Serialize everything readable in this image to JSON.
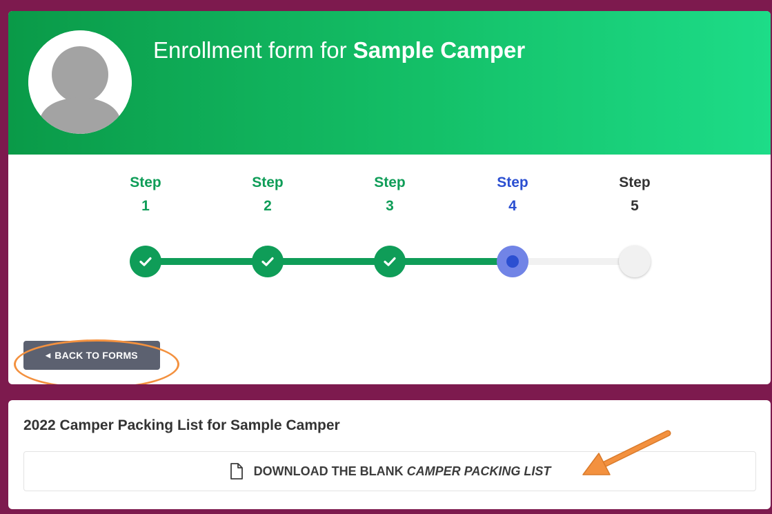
{
  "header": {
    "title_prefix": "Enrollment form for ",
    "camper_name": "Sample Camper",
    "avatar_icon": "user-silhouette-icon"
  },
  "steps": [
    {
      "label": "Step",
      "number": "1",
      "status": "complete"
    },
    {
      "label": "Step",
      "number": "2",
      "status": "complete"
    },
    {
      "label": "Step",
      "number": "3",
      "status": "complete"
    },
    {
      "label": "Step",
      "number": "4",
      "status": "current"
    },
    {
      "label": "Step",
      "number": "5",
      "status": "upcoming"
    }
  ],
  "back_button": {
    "label": "BACK TO FORMS",
    "icon": "caret-left-icon"
  },
  "packing_list": {
    "title": "2022 Camper Packing List for Sample Camper",
    "download_prefix": "DOWNLOAD THE BLANK ",
    "download_emphasis": "CAMPER PACKING LIST",
    "icon": "file-icon"
  },
  "annotations": {
    "highlight_color": "#f3913f"
  },
  "colors": {
    "page_background": "#7d1a4e",
    "complete": "#0f9d58",
    "current": "#2b4fd1",
    "upcoming": "#f1f1f1",
    "button": "#5c6170"
  }
}
